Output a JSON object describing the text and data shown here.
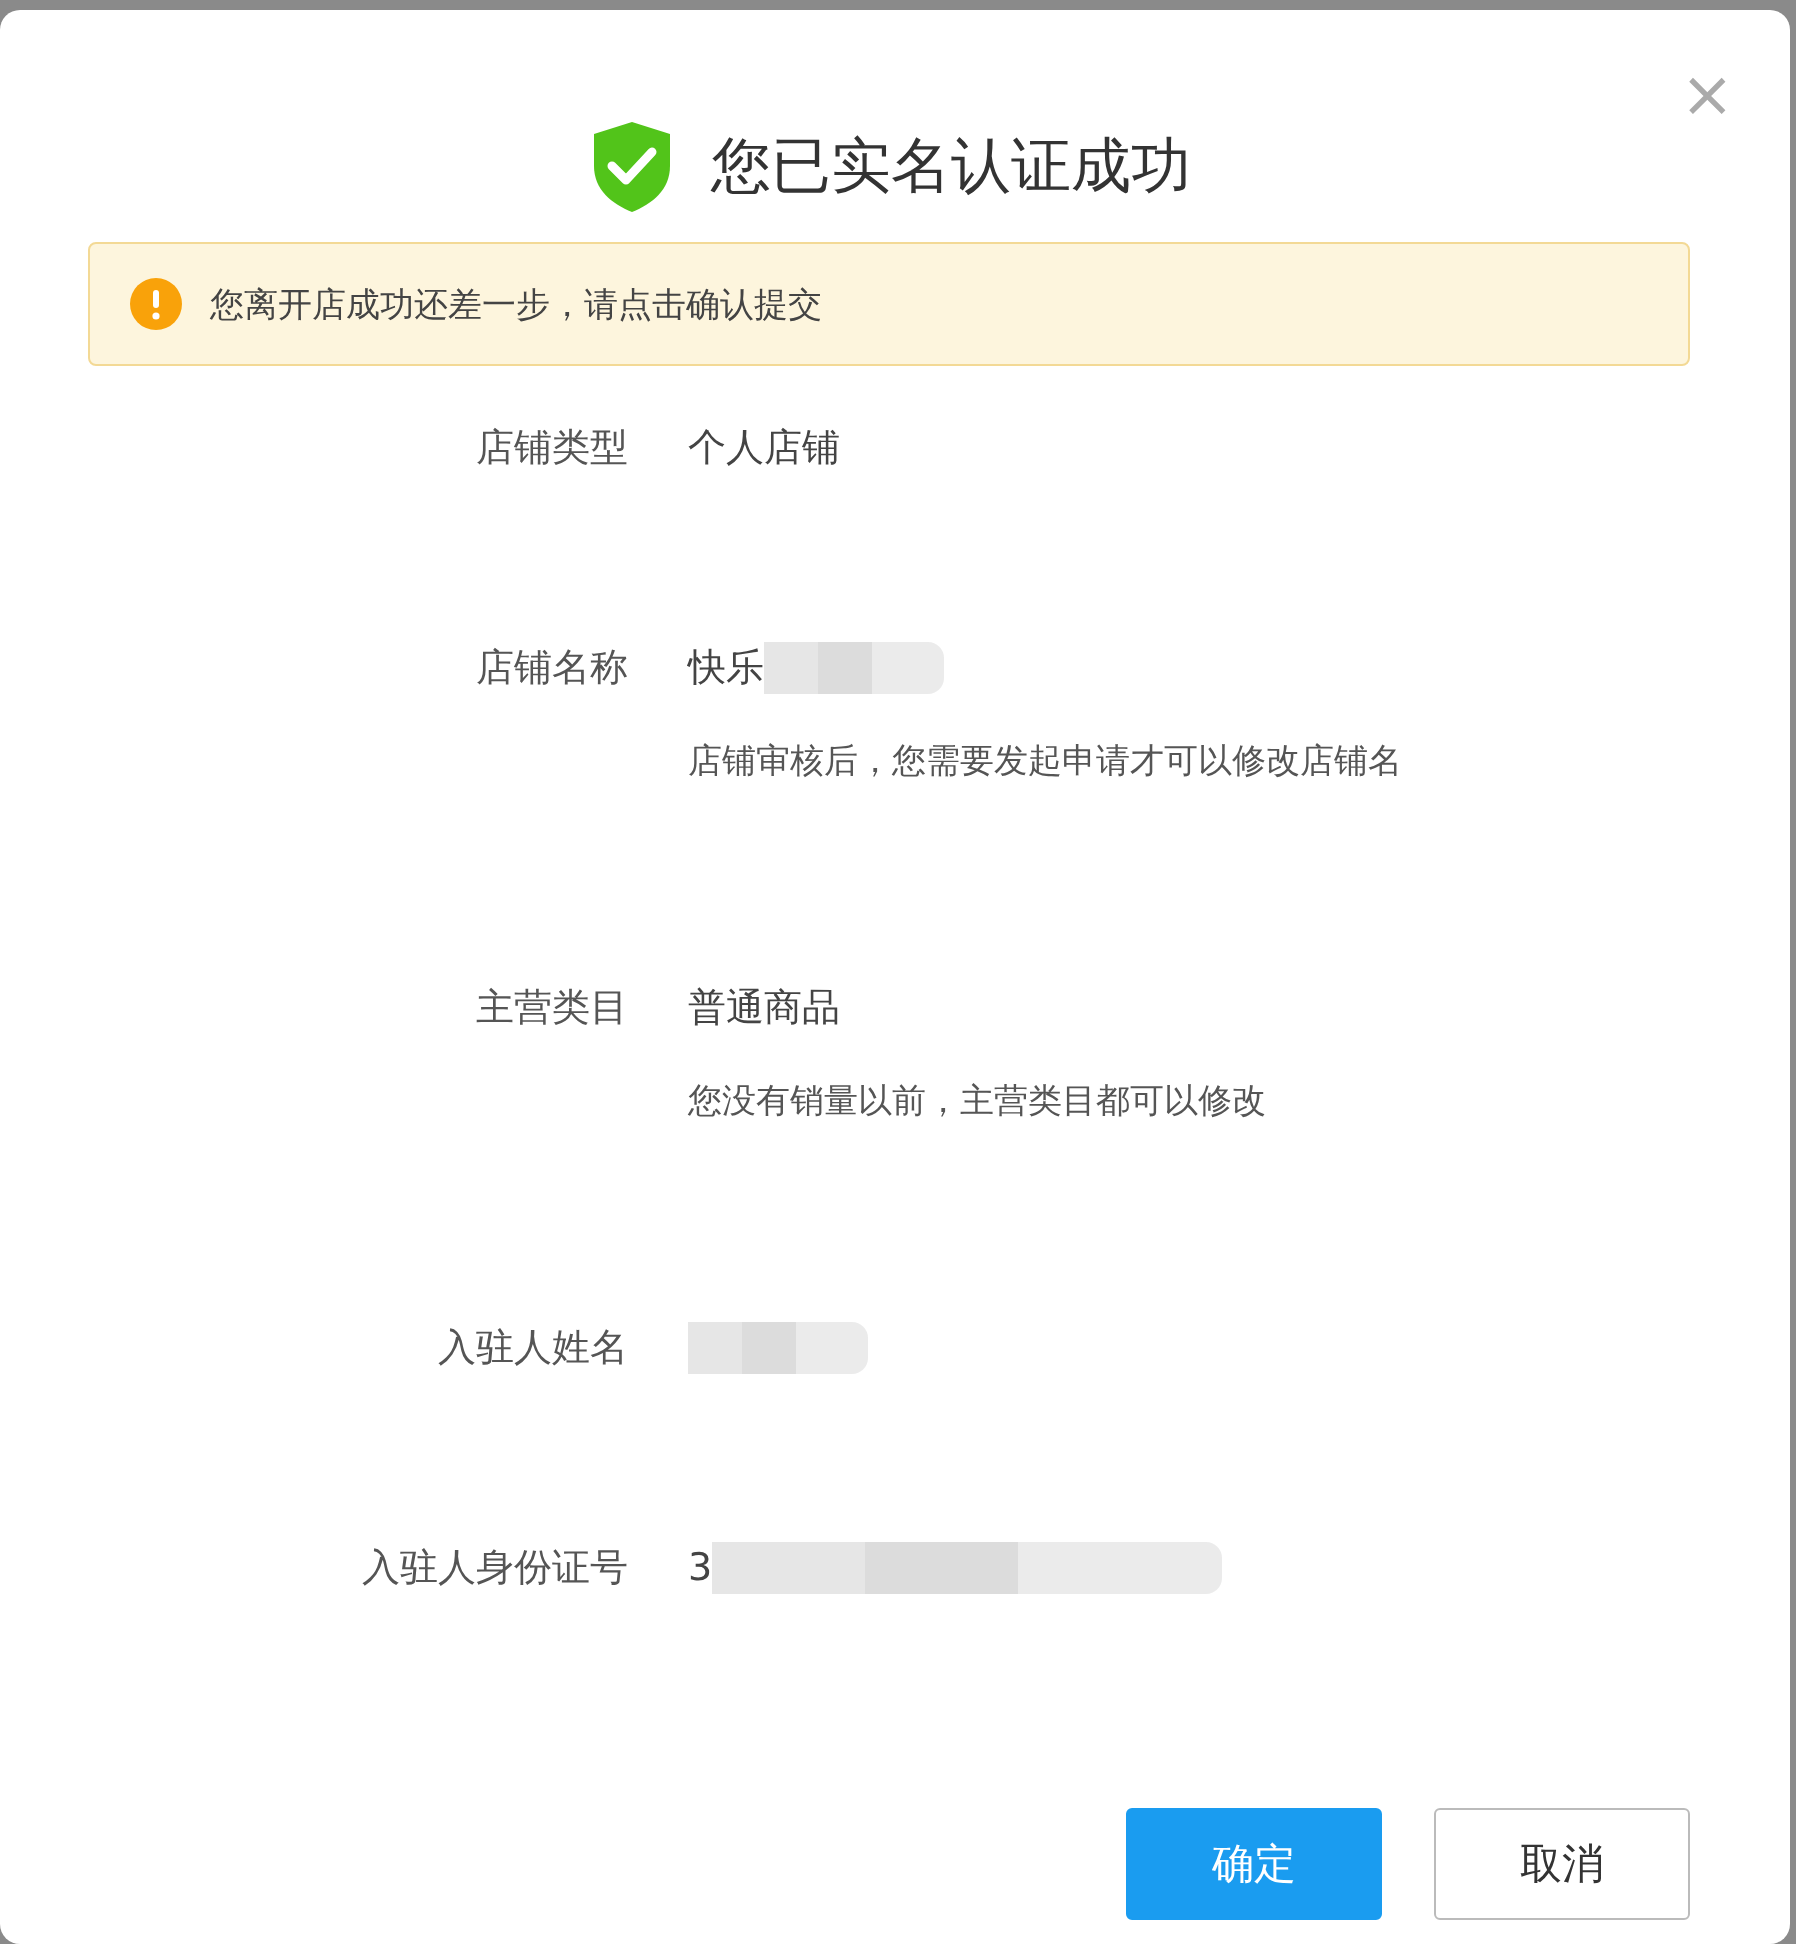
{
  "dialog": {
    "title": "您已实名认证成功",
    "close": "×"
  },
  "alert": {
    "text": "您离开店成功还差一步，请点击确认提交"
  },
  "fields": [
    {
      "label": "店铺类型",
      "value": "个人店铺",
      "kind": "plain"
    },
    {
      "label": "店铺名称",
      "value": "快乐",
      "kind": "masked",
      "hint": "店铺审核后，您需要发起申请才可以修改店铺名"
    },
    {
      "label": "主营类目",
      "value": "普通商品",
      "kind": "plain",
      "hint": "您没有销量以前，主营类目都可以修改"
    },
    {
      "label": "入驻人姓名",
      "kind": "masked"
    },
    {
      "label": "入驻人身份证号",
      "value": "3",
      "kind": "masklong"
    }
  ],
  "buttons": [
    {
      "label": "确定",
      "primary": true
    },
    {
      "label": "取消",
      "primary": false
    }
  ]
}
